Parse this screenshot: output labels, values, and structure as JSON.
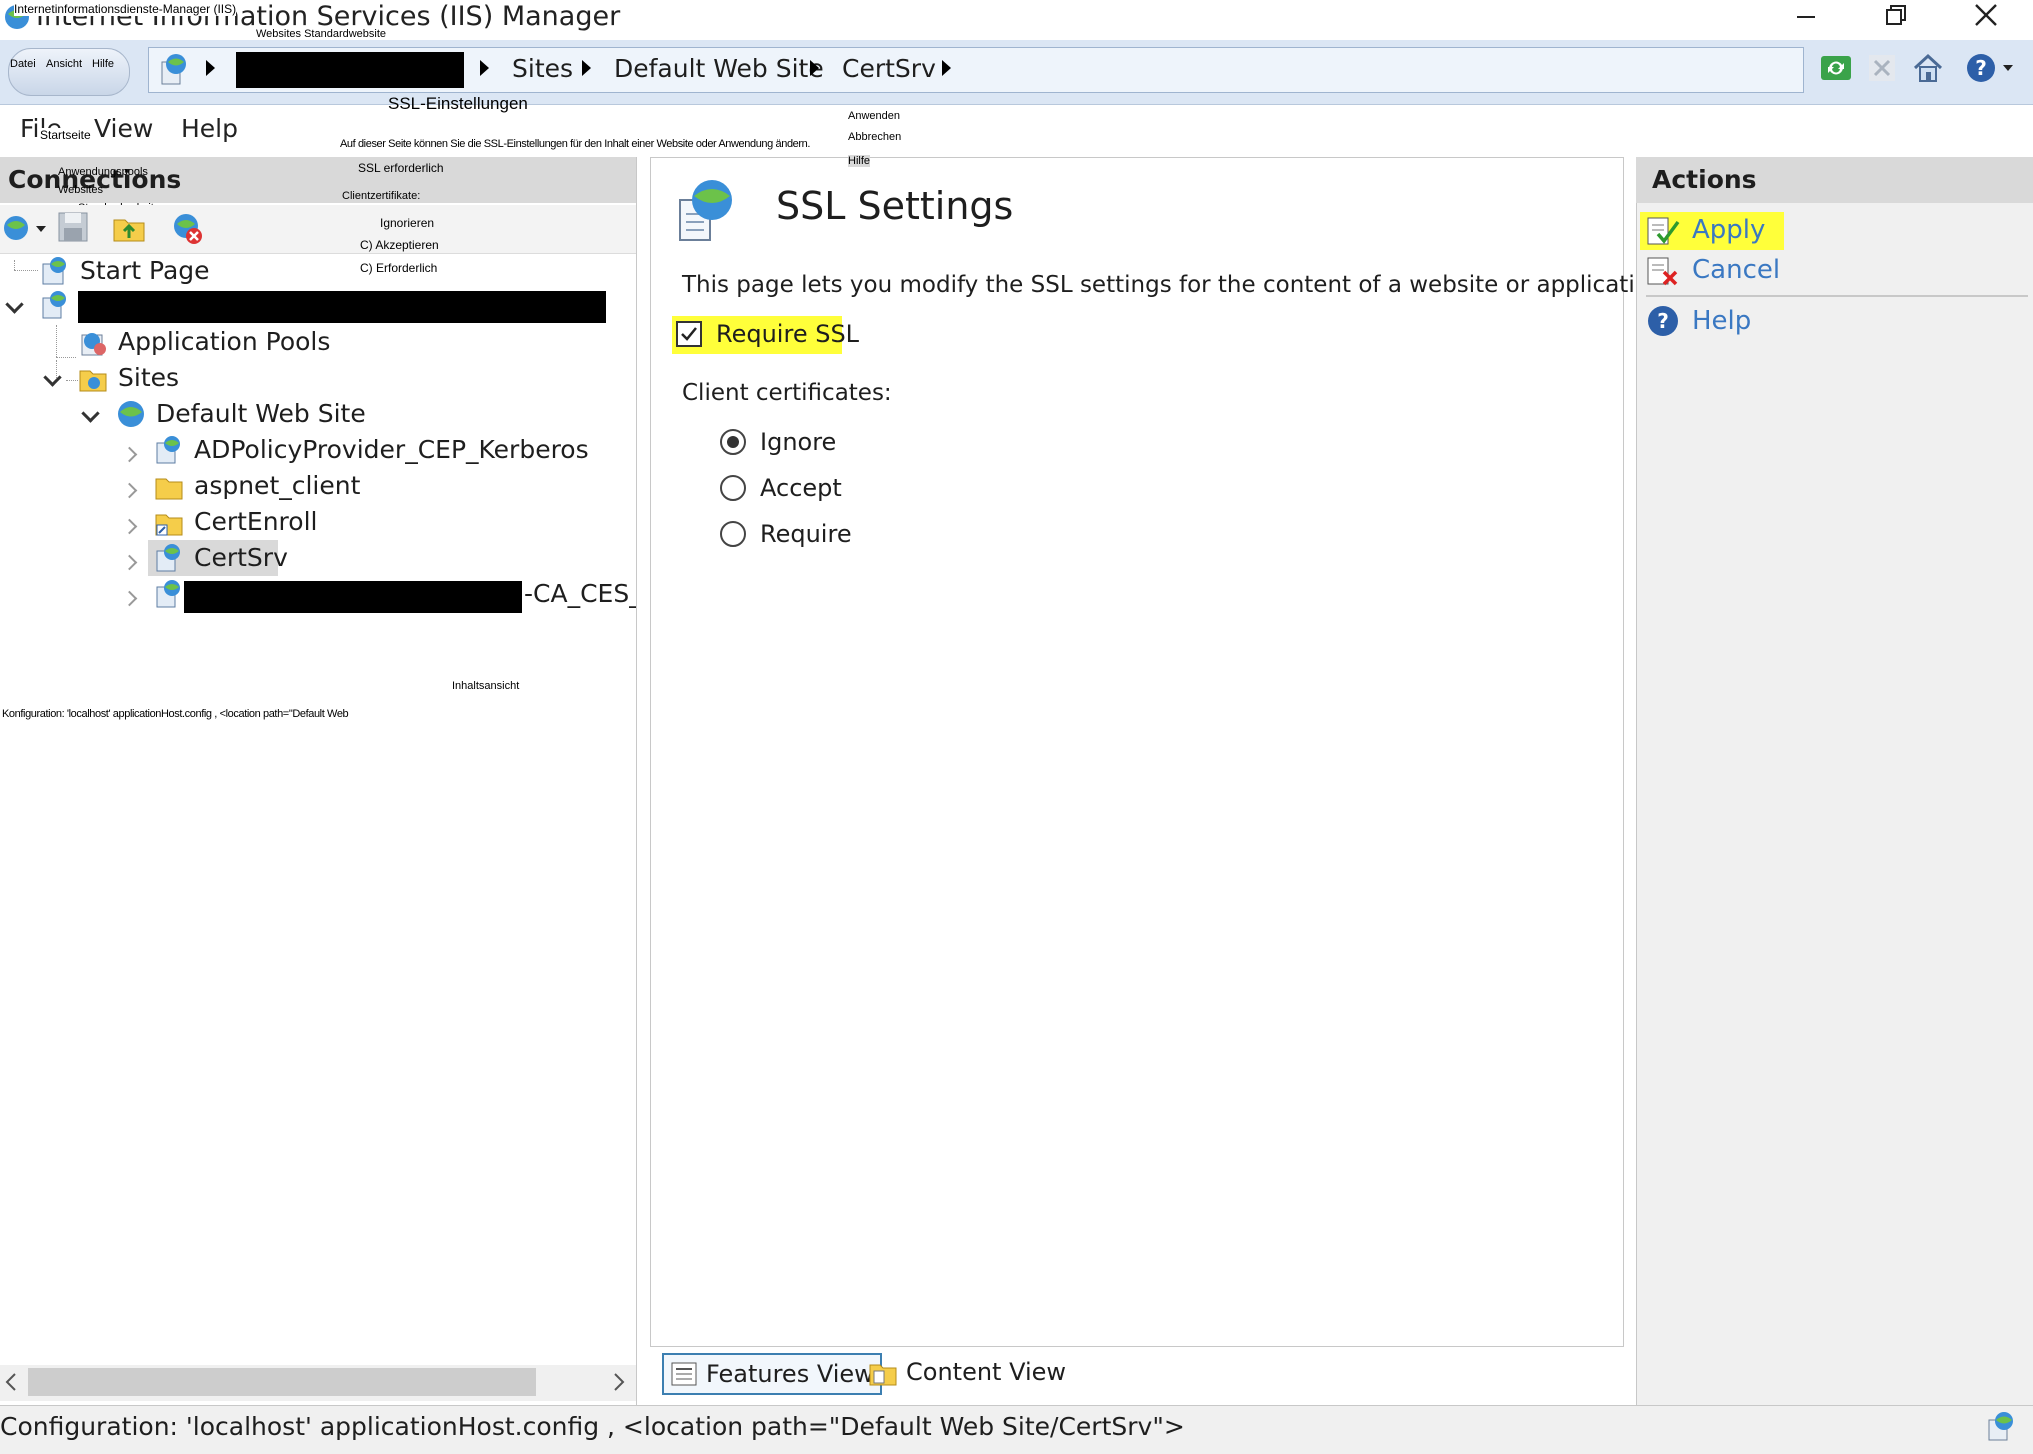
{
  "window": {
    "title": "Internet Information Services (IIS) Manager",
    "overlay_title": "Internetinformationsdienste-Manager (IIS)",
    "overlay_crumbs": "Websites  Standardwebsite",
    "minimize_icon": "minimize-icon",
    "restore_icon": "restore-icon",
    "close_icon": "close-icon"
  },
  "navbar": {
    "overlay_menu": {
      "file": "Datei",
      "view": "Ansicht",
      "help": "Hilfe"
    },
    "breadcrumbs": [
      "Sites",
      "Default Web Site",
      "CertSrv"
    ],
    "redacted_server": ""
  },
  "menu": {
    "file": "File",
    "view": "View",
    "help": "Help",
    "overlay_start": "Startseite"
  },
  "connections": {
    "title": "Connections",
    "overlay_labels": [
      "Anwendungspools",
      "Websites",
      "Standardwebsite"
    ],
    "tree": {
      "start_page": "Start Page",
      "app_pools": "Application Pools",
      "sites": "Sites",
      "default_web_site": "Default Web Site",
      "children": [
        "ADPolicyProvider_CEP_Kerberos",
        "aspnet_client",
        "CertEnroll",
        "CertSrv"
      ],
      "last_child_suffix": "-CA_CES_K"
    },
    "overlay_content_view": "Inhaltsansicht",
    "overlay_config": "Konfiguration: 'localhost' applicationHost.config , <location path=\"Default Web"
  },
  "feature": {
    "title": "SSL Settings",
    "overlay_title": "SSL-Einstellungen",
    "description": "This page lets you modify the SSL settings for the content of a website or application.",
    "overlay_description": "Auf dieser Seite können Sie die SSL-Einstellungen für den Inhalt einer Website oder Anwendung ändern.",
    "require_ssl_label": "Require SSL",
    "require_ssl_checked": true,
    "overlay_require_ssl": "SSL erforderlich",
    "client_certs_label": "Client certificates:",
    "overlay_client_certs": "Clientzertifikate:",
    "options": [
      "Ignore",
      "Accept",
      "Require"
    ],
    "selected_option": "Ignore",
    "overlay_options": [
      "Ignorieren",
      "C) Akzeptieren",
      "C) Erforderlich"
    ]
  },
  "view_tabs": {
    "features": "Features View",
    "content": "Content View"
  },
  "actions": {
    "title": "Actions",
    "apply": "Apply",
    "cancel": "Cancel",
    "help": "Help",
    "overlay": {
      "apply": "Anwenden",
      "cancel": "Abbrechen",
      "help": "Hilfe"
    }
  },
  "status": {
    "text": "Configuration: 'localhost' applicationHost.config , <location path=\"Default Web Site/CertSrv\">"
  },
  "colors": {
    "highlight": "#ffff3a",
    "link": "#3a78c2",
    "header_bg": "#d9d9d9",
    "nav_bg": "#dbe6f4"
  }
}
